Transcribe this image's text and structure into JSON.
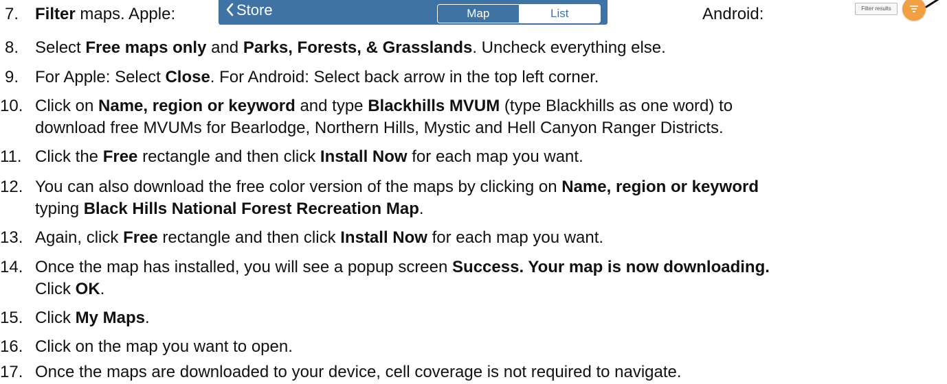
{
  "steps": [
    {
      "number": "7.",
      "segments": [
        {
          "text": "Filter",
          "bold": true
        },
        {
          "text": " maps. Apple:",
          "bold": false
        }
      ],
      "apple_shot": {
        "back_label": "Store",
        "seg_map": "Map",
        "seg_list": "List"
      },
      "android_label": "Android:",
      "android_shot": {
        "button_label": "Filter results"
      }
    },
    {
      "number": "8.",
      "lines": [
        [
          {
            "text": "Select ",
            "bold": false
          },
          {
            "text": "Free maps only",
            "bold": true
          },
          {
            "text": " and ",
            "bold": false
          },
          {
            "text": "Parks, Forests, & Grasslands",
            "bold": true
          },
          {
            "text": ". Uncheck everything else.",
            "bold": false
          }
        ]
      ]
    },
    {
      "number": "9.",
      "lines": [
        [
          {
            "text": "For Apple: Select ",
            "bold": false
          },
          {
            "text": "Close",
            "bold": true
          },
          {
            "text": ". For Android: Select back arrow in the top left corner.",
            "bold": false
          }
        ]
      ]
    },
    {
      "number": "10.",
      "lines": [
        [
          {
            "text": "Click on ",
            "bold": false
          },
          {
            "text": "Name, region or keyword",
            "bold": true
          },
          {
            "text": " and type ",
            "bold": false
          },
          {
            "text": "Blackhills MVUM",
            "bold": true
          },
          {
            "text": " (type Blackhills as one word) to",
            "bold": false
          }
        ],
        [
          {
            "text": "download free MVUMs for Bearlodge, Northern Hills, Mystic and Hell Canyon Ranger Districts.",
            "bold": false
          }
        ]
      ]
    },
    {
      "number": "11.",
      "lines": [
        [
          {
            "text": "Click the ",
            "bold": false
          },
          {
            "text": "Free",
            "bold": true
          },
          {
            "text": " rectangle and then click ",
            "bold": false
          },
          {
            "text": "Install Now",
            "bold": true
          },
          {
            "text": " for each map you want.",
            "bold": false
          }
        ]
      ]
    },
    {
      "number": "12.",
      "lines": [
        [
          {
            "text": "You can also download the free color version of the maps by clicking on ",
            "bold": false
          },
          {
            "text": "Name, region or keyword",
            "bold": true
          }
        ],
        [
          {
            "text": "typing ",
            "bold": false
          },
          {
            "text": "Black Hills National Forest Recreation Map",
            "bold": true
          },
          {
            "text": ".",
            "bold": false
          }
        ]
      ]
    },
    {
      "number": "13.",
      "lines": [
        [
          {
            "text": "Again, click ",
            "bold": false
          },
          {
            "text": "Free",
            "bold": true
          },
          {
            "text": " rectangle and then click ",
            "bold": false
          },
          {
            "text": "Install Now",
            "bold": true
          },
          {
            "text": " for each map you want.",
            "bold": false
          }
        ]
      ]
    },
    {
      "number": "14.",
      "lines": [
        [
          {
            "text": "Once the map has installed, you will see a popup screen ",
            "bold": false
          },
          {
            "text": "Success. Your map is now downloading.",
            "bold": true
          }
        ],
        [
          {
            "text": "Click ",
            "bold": false
          },
          {
            "text": "OK",
            "bold": true
          },
          {
            "text": ".",
            "bold": false
          }
        ]
      ]
    },
    {
      "number": "15.",
      "lines": [
        [
          {
            "text": "Click ",
            "bold": false
          },
          {
            "text": "My Maps",
            "bold": true
          },
          {
            "text": ".",
            "bold": false
          }
        ]
      ]
    },
    {
      "number": "16.",
      "lines": [
        [
          {
            "text": "Click on the map you want to open.",
            "bold": false
          }
        ]
      ]
    },
    {
      "number": "17.",
      "lines": [
        [
          {
            "text": "Once the maps are downloaded to your device, cell coverage is not required to navigate.",
            "bold": false
          }
        ]
      ]
    }
  ],
  "colors": {
    "apple_bar": "#3f73a3",
    "android_fab": "#f0a042"
  },
  "icons": {
    "apple_back": "chevron-left-icon",
    "apple_filter": "filter-funnel-icon",
    "android_fab": "filter-lines-icon",
    "annotation": "pointer-arrow-icon"
  }
}
